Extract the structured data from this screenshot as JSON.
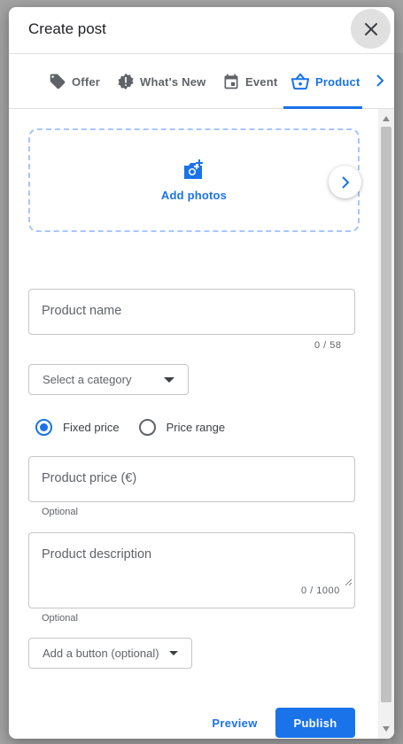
{
  "dialog": {
    "title": "Create post"
  },
  "tabs": [
    {
      "label": "Offer",
      "icon": "tag-icon"
    },
    {
      "label": "What's New",
      "icon": "badge-alert-icon"
    },
    {
      "label": "Event",
      "icon": "calendar-icon"
    },
    {
      "label": "Product",
      "icon": "basket-icon",
      "active": true
    }
  ],
  "photos": {
    "label": "Add photos"
  },
  "form": {
    "product_name_placeholder": "Product name",
    "product_name_counter": "0 / 58",
    "category_placeholder": "Select a category",
    "price_options": {
      "fixed": "Fixed price",
      "range": "Price range",
      "selected": "fixed"
    },
    "price_placeholder": "Product price (€)",
    "price_helper": "Optional",
    "description_placeholder": "Product description",
    "description_counter": "0 / 1000",
    "description_helper": "Optional",
    "button_select": "Add a button (optional)"
  },
  "footer": {
    "preview_label": "Preview",
    "publish_label": "Publish"
  },
  "colors": {
    "accent": "#1a73e8",
    "dashed_border": "#a8c7fa"
  }
}
